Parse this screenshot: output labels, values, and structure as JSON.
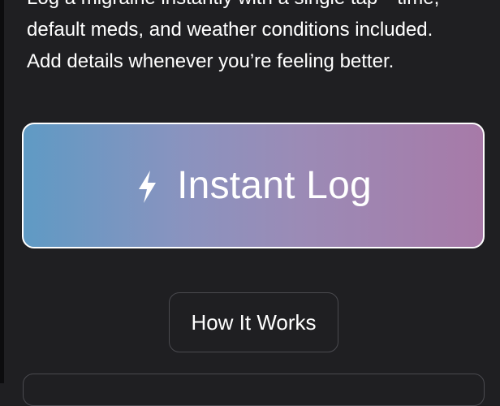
{
  "intro": {
    "line1": "Log a migraine instantly with a single tap—time,",
    "line2": "default meds, and weather conditions included.",
    "line3": "Add details whenever you’re feeling better."
  },
  "instant_log": {
    "icon": "lightning-bolt-icon",
    "label": "Instant Log"
  },
  "how_it_works": {
    "label": "How It Works"
  },
  "colors": {
    "background": "#1f1f22",
    "gradient_start": "#5f9ac4",
    "gradient_end": "#a77aa8",
    "text": "#ffffff",
    "border_muted": "#4a4a4f"
  }
}
